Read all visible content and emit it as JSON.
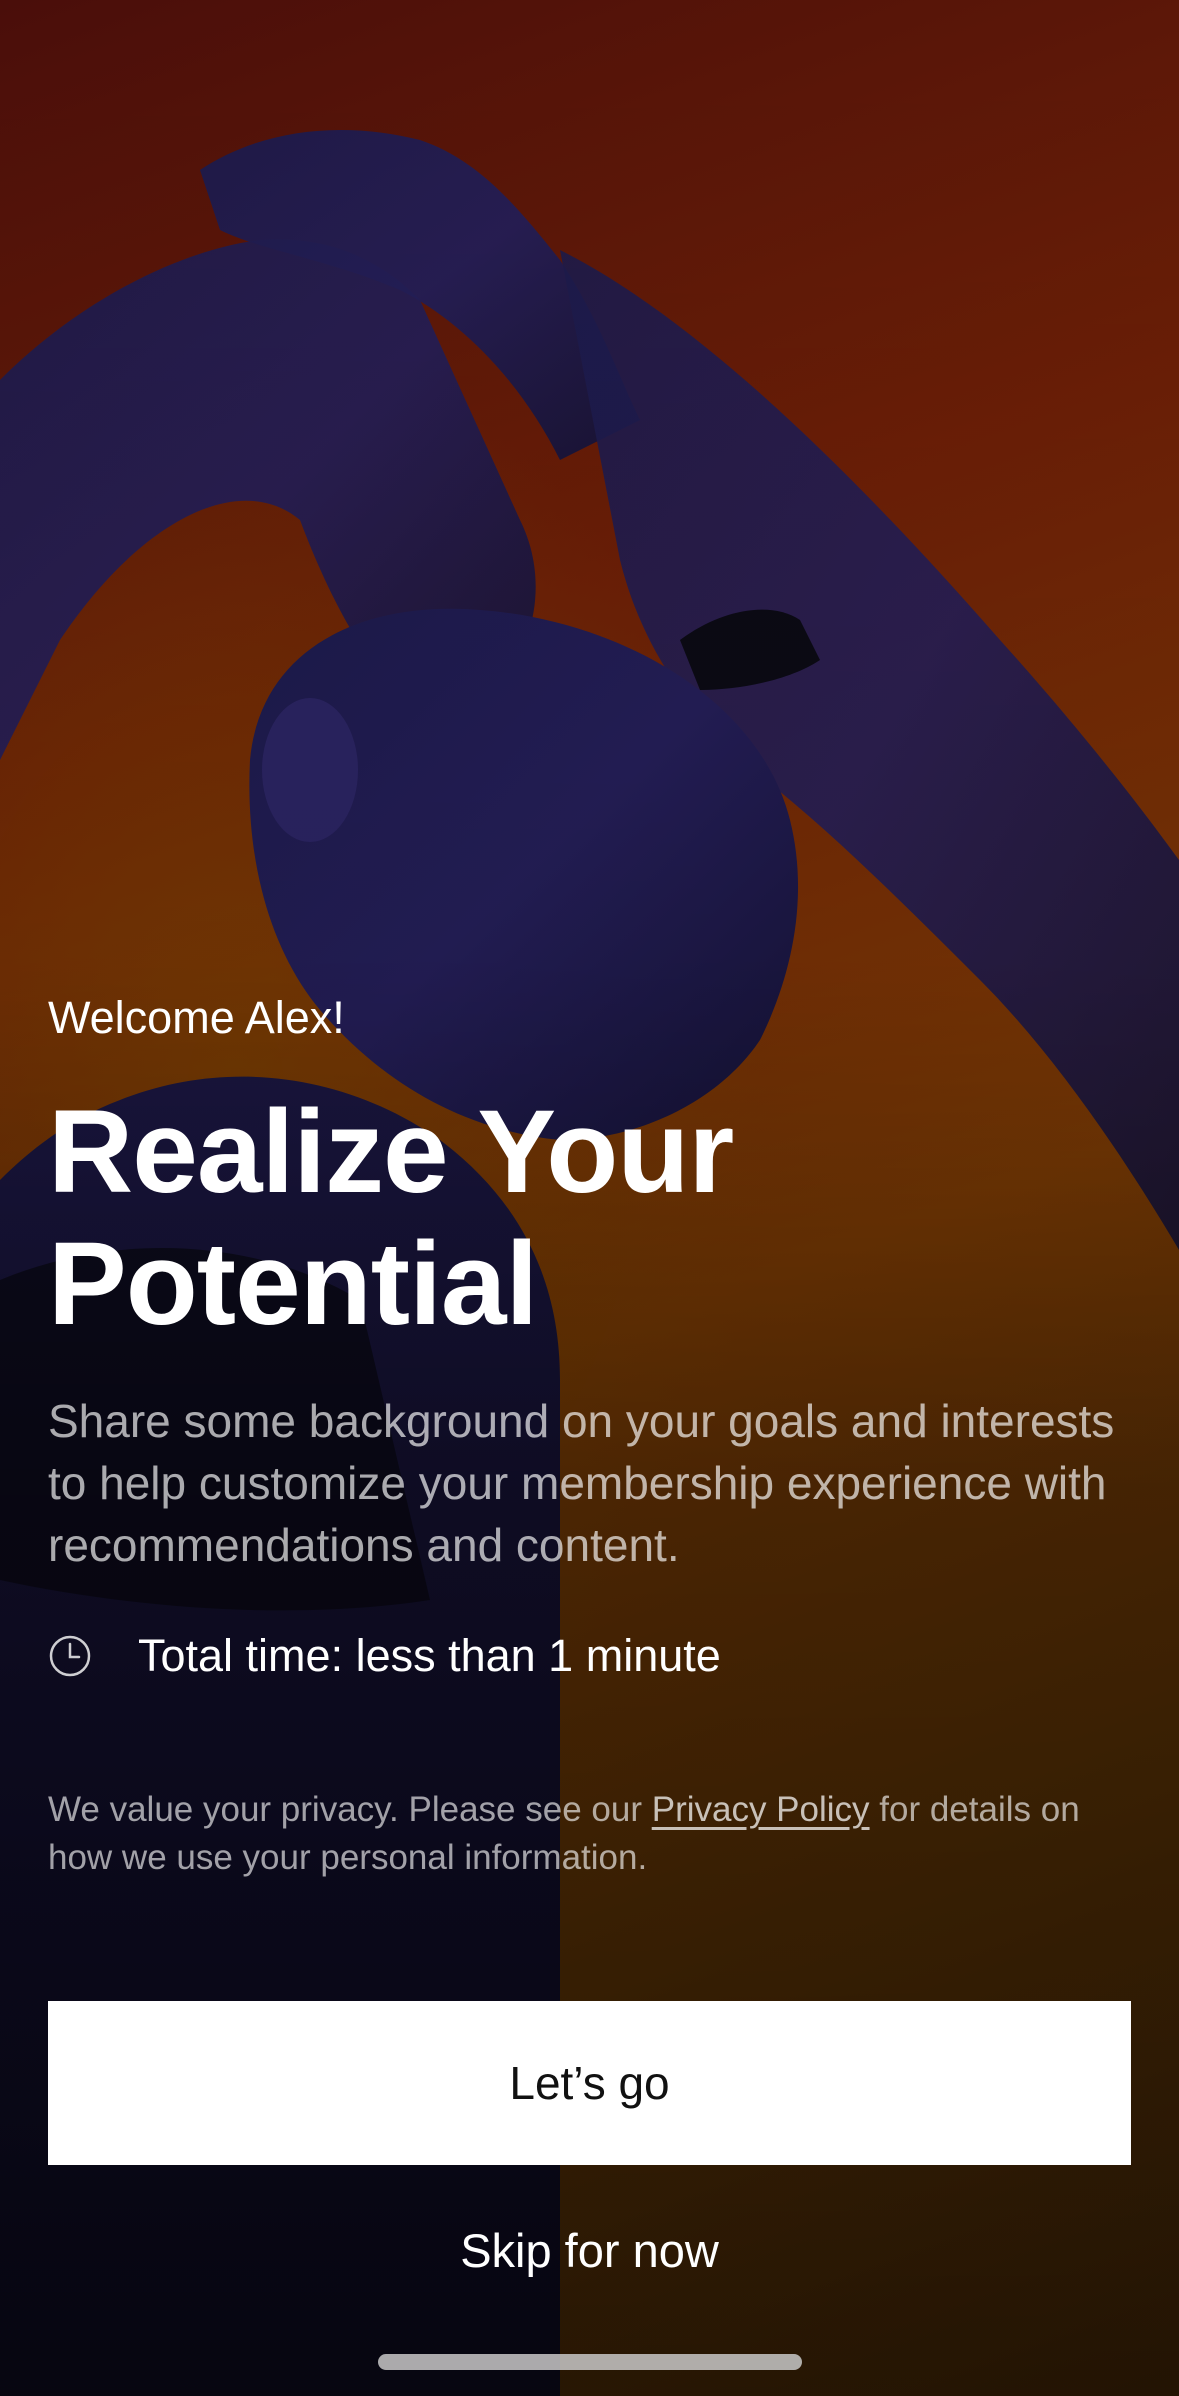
{
  "screen": {
    "welcome": "Welcome Alex!",
    "headline_line1": "Realize Your",
    "headline_line2": "Potential",
    "description": "Share some background on your goals and interests to help customize your membership experience with recommendations and content.",
    "time_text": "Total time: less than 1 minute",
    "time_icon": "clock-icon",
    "privacy_prefix": "We value your privacy. Please see our ",
    "privacy_link": "Privacy Policy",
    "privacy_suffix": " for details on how we use your personal information.",
    "primary_button": "Let’s go",
    "secondary_button": "Skip for now"
  },
  "colors": {
    "primary_button_bg": "#ffffff",
    "primary_button_text": "#111111",
    "background_top": "#4a0e0a",
    "background_bottom": "#5a3205"
  }
}
